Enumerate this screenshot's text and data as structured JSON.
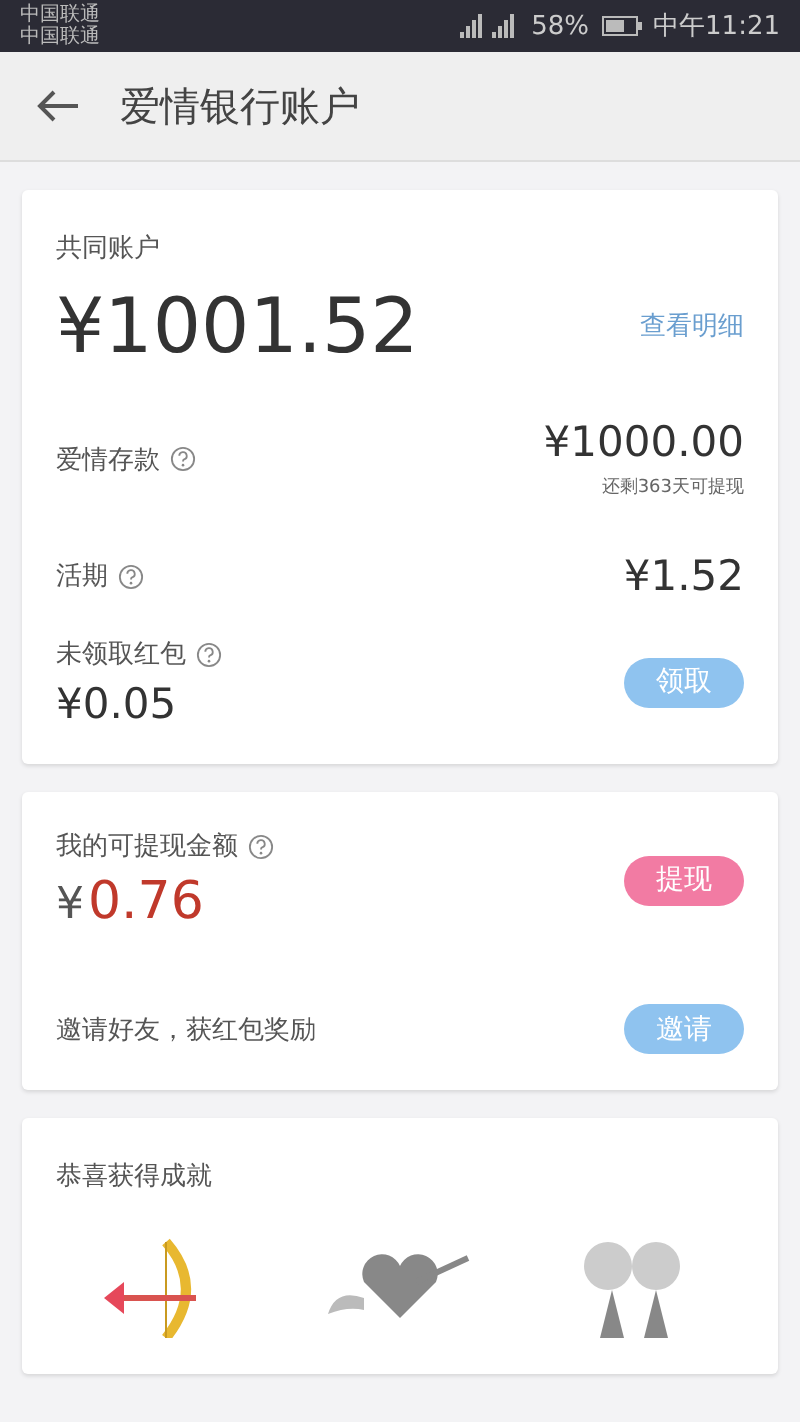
{
  "status_bar": {
    "carriers": [
      "中国联通",
      "中国联通"
    ],
    "battery_text": "58%",
    "time": "中午11:21"
  },
  "header": {
    "title": "爱情银行账户"
  },
  "joint_account": {
    "label": "共同账户",
    "total": "¥1001.52",
    "detail_link": "查看明细",
    "rows": [
      {
        "label": "爱情存款",
        "amount": "¥1000.00",
        "note": "还剩363天可提现"
      },
      {
        "label": "活期",
        "amount": "¥1.52"
      }
    ],
    "red_packet": {
      "label": "未领取红包",
      "amount": "¥0.05",
      "button": "领取"
    }
  },
  "withdraw": {
    "label": "我的可提现金额",
    "currency": "¥",
    "amount": "0.76",
    "button": "提现",
    "invite_text": "邀请好友，获红包奖励",
    "invite_button": "邀请"
  },
  "achievements": {
    "title": "恭喜获得成就",
    "items": [
      {
        "kind": "bow",
        "unlocked": true
      },
      {
        "kind": "winged-heart",
        "unlocked": false
      },
      {
        "kind": "couple",
        "unlocked": false
      }
    ]
  }
}
